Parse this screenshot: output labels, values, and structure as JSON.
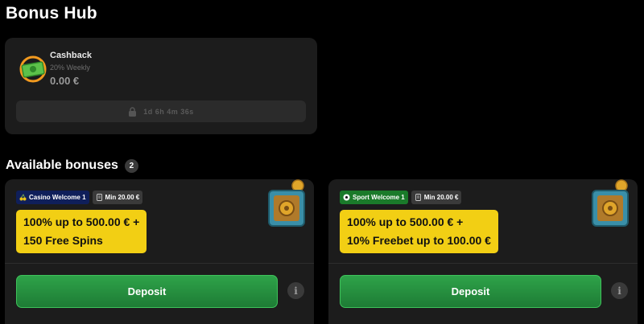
{
  "page": {
    "title": "Bonus Hub"
  },
  "cashback": {
    "icon": "cash-money-icon",
    "name": "Cashback",
    "rate": "20% Weekly",
    "amount": "0.00 €",
    "timer": "1d 6h 4m 36s",
    "timer_icon": "lock-icon"
  },
  "available": {
    "title": "Available bonuses",
    "count": "2"
  },
  "bonuses": [
    {
      "tag": "Casino Welcome 1",
      "tag_icon": "cherries-icon",
      "min": "Min 20.00 €",
      "min_icon": "document-icon",
      "offer_line1": "100% up to 500.00 € +",
      "offer_line2": "150 Free Spins",
      "image_icon": "treasure-safe-icon",
      "deposit_label": "Deposit",
      "info_label": "i"
    },
    {
      "tag": "Sport Welcome 1",
      "tag_icon": "soccer-ball-icon",
      "min": "Min 20.00 €",
      "min_icon": "document-icon",
      "offer_line1": "100% up to 500.00 € +",
      "offer_line2": "10% Freebet up to 100.00 €",
      "image_icon": "treasure-safe-icon",
      "deposit_label": "Deposit",
      "info_label": "i"
    }
  ],
  "colors": {
    "accent_green": "#2ea349",
    "offer_yellow": "#f2cf14",
    "card_bg": "#1c1c1c",
    "casino_tag": "#0f1f5a",
    "sport_tag": "#1a7a2a"
  }
}
